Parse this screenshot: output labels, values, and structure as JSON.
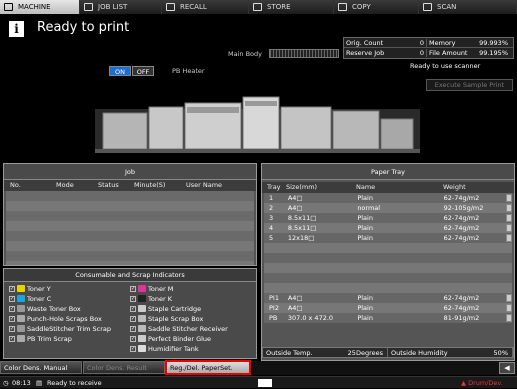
{
  "tabs": [
    {
      "label": "MACHINE",
      "active": true
    },
    {
      "label": "JOB LIST"
    },
    {
      "label": "RECALL"
    },
    {
      "label": "STORE"
    },
    {
      "label": "COPY"
    },
    {
      "label": "SCAN"
    }
  ],
  "status": "Ready to print",
  "main_body": "Main Body",
  "counts": {
    "orig_count_label": "Orig. Count",
    "orig_count": "0",
    "memory_label": "Memory",
    "memory": "99.993%",
    "reserve_job_label": "Reserve Job",
    "reserve_job": "0",
    "file_amount_label": "File Amount",
    "file_amount": "99.195%"
  },
  "ready_scan": "Ready to use scanner",
  "sample_print": "Execute Sample Print",
  "pb_heater": {
    "on": "ON",
    "off": "OFF",
    "label": "PB Heater"
  },
  "job": {
    "title": "Job",
    "columns": [
      "No.",
      "Mode",
      "Status",
      "Minute(S)",
      "User Name"
    ]
  },
  "paper_tray": {
    "title": "Paper Tray",
    "columns": [
      "Tray",
      "Size(mm)",
      "Name",
      "Weight"
    ],
    "rows": [
      {
        "tray": "1",
        "size": "A4□",
        "name": "Plain",
        "weight": "62-74g/m2"
      },
      {
        "tray": "2",
        "size": "A4□",
        "name": "normal",
        "weight": "92-105g/m2"
      },
      {
        "tray": "3",
        "size": "8.5x11□",
        "name": "Plain",
        "weight": "62-74g/m2"
      },
      {
        "tray": "4",
        "size": "8.5x11□",
        "name": "Plain",
        "weight": "62-74g/m2"
      },
      {
        "tray": "5",
        "size": "12x18□",
        "name": "Plain",
        "weight": "62-74g/m2"
      },
      {
        "tray": "",
        "size": "",
        "name": "",
        "weight": ""
      },
      {
        "tray": "",
        "size": "",
        "name": "",
        "weight": ""
      },
      {
        "tray": "",
        "size": "",
        "name": "",
        "weight": ""
      },
      {
        "tray": "",
        "size": "",
        "name": "",
        "weight": ""
      },
      {
        "tray": "",
        "size": "",
        "name": "",
        "weight": ""
      },
      {
        "tray": "PI1",
        "size": "A4□",
        "name": "Plain",
        "weight": "62-74g/m2"
      },
      {
        "tray": "PI2",
        "size": "A4□",
        "name": "Plain",
        "weight": "62-74g/m2"
      },
      {
        "tray": "PB",
        "size": "307.0 x 472.0",
        "name": "Plain",
        "weight": "81-91g/m2"
      }
    ]
  },
  "outside_temp_label": "Outside Temp.",
  "outside_temp": "25Degrees",
  "outside_humidity_label": "Outside Humidity",
  "outside_humidity": "50%",
  "consumables": {
    "title": "Consumable and Scrap Indicators",
    "items": [
      {
        "label": "Toner Y",
        "color": "#e8d200"
      },
      {
        "label": "Toner M",
        "color": "#e0339a"
      },
      {
        "label": "Toner C",
        "color": "#1aa5e0"
      },
      {
        "label": "Toner K",
        "color": "#222222"
      },
      {
        "label": "Waste Toner Box",
        "color": "#999999"
      },
      {
        "label": "Staple Cartridge",
        "color": "#cccccc"
      },
      {
        "label": "Punch-Hole Scraps Box",
        "color": "#aaaaaa"
      },
      {
        "label": "Staple Scrap Box",
        "color": "#bbbbbb"
      },
      {
        "label": "SaddleStitcher Trim Scrap",
        "color": "#999999"
      },
      {
        "label": "Saddle Stitcher Receiver",
        "color": "#bbbbbb"
      },
      {
        "label": "PB Trim Scrap",
        "color": "#aaaaaa"
      },
      {
        "label": "Perfect Binder Glue",
        "color": "#cccccc"
      },
      {
        "label": "",
        "color": ""
      },
      {
        "label": "Humidifier Tank",
        "color": "#dddddd"
      }
    ]
  },
  "bottom_buttons": {
    "color_dens_manual": "Color Dens. Manual",
    "color_dens_result": "Color Dens. Result",
    "reg_del": "Reg./Del. PaperSet."
  },
  "statusbar": {
    "time": "08:13",
    "text": "Ready to receive",
    "drum": "Drum/Dev."
  }
}
